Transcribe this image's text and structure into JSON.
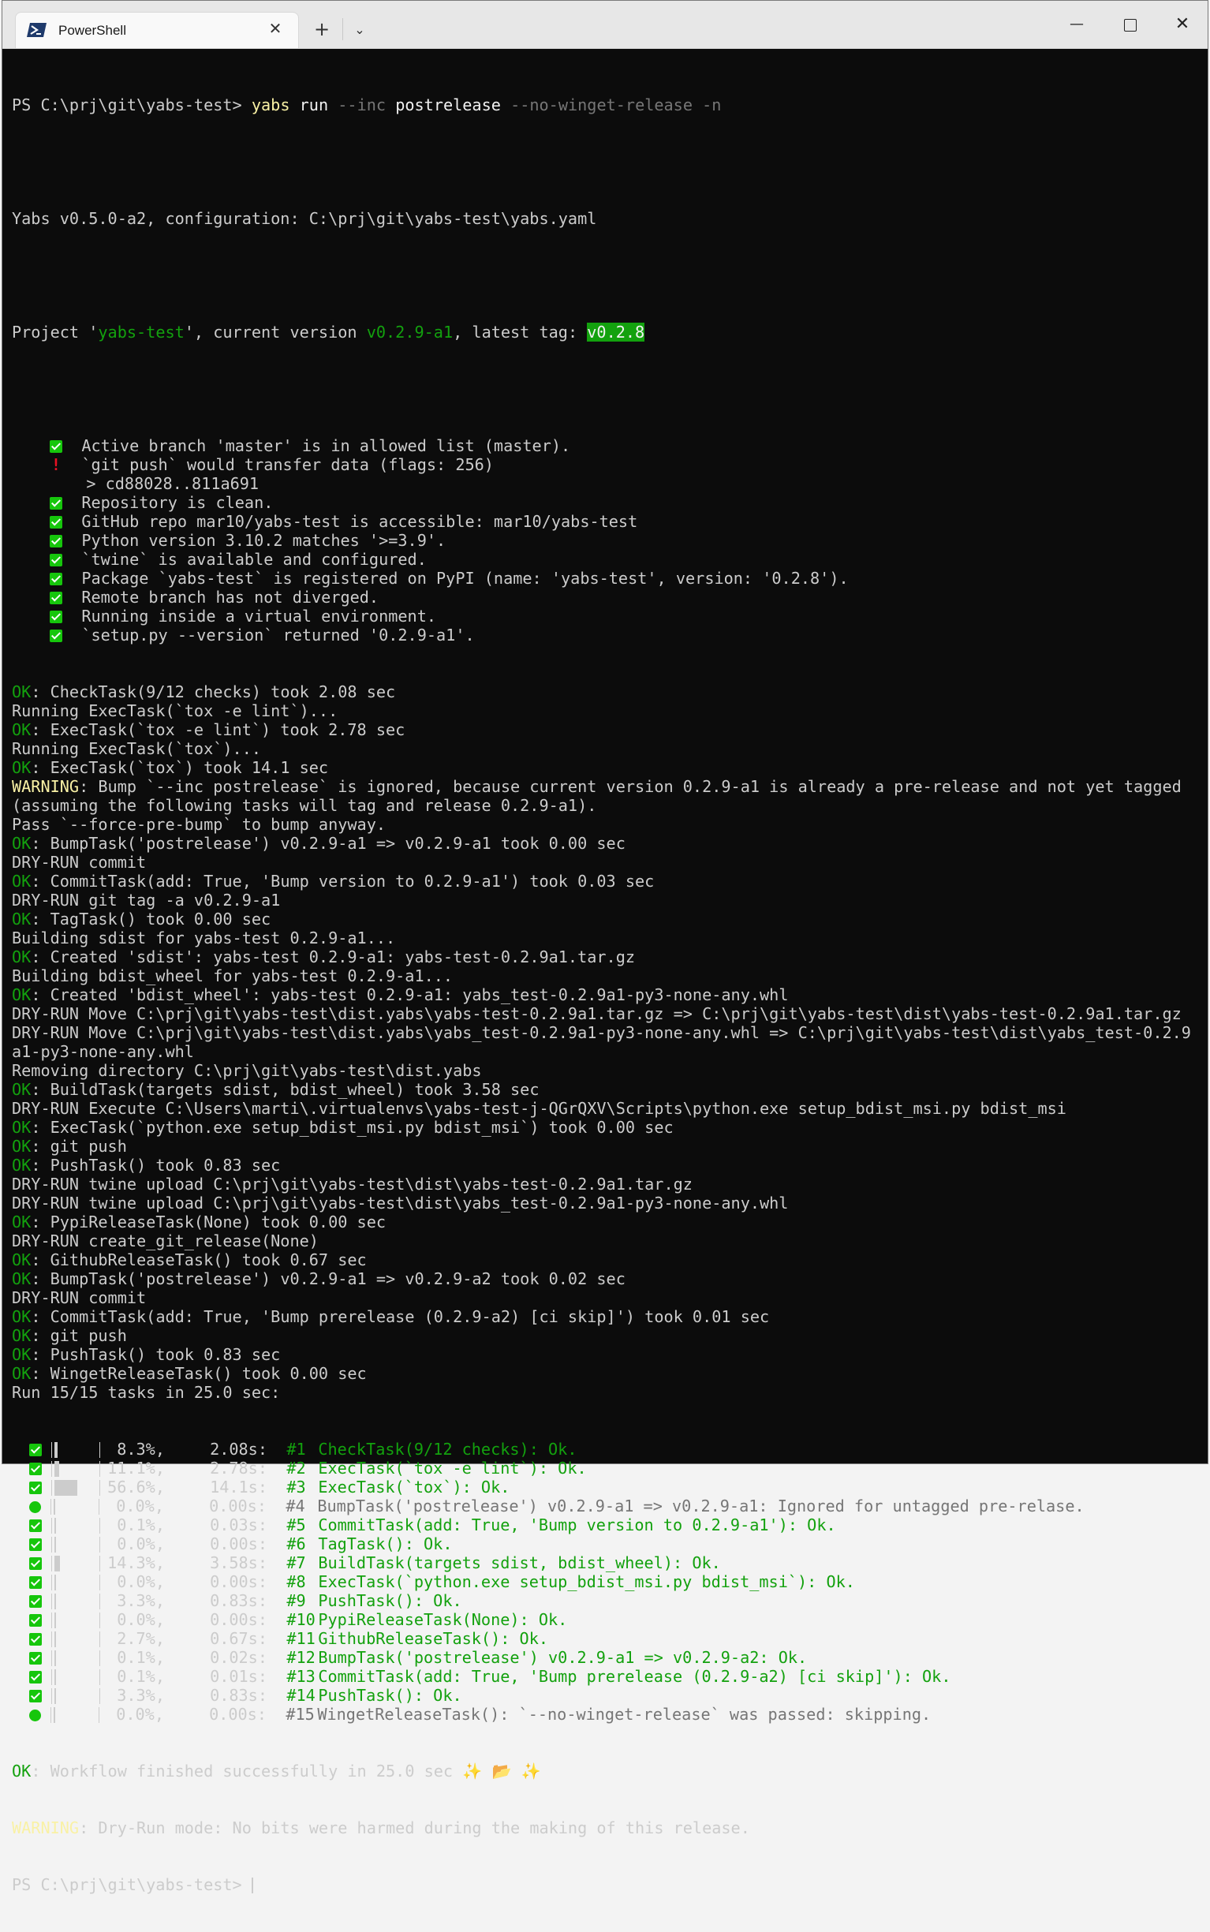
{
  "window": {
    "tab_title": "PowerShell",
    "tab_close": "✕",
    "new_tab": "+",
    "dropdown": "⌄",
    "minimize": "—",
    "close": "✕"
  },
  "terminal": {
    "prompt": "PS C:\\prj\\git\\yabs-test>",
    "cmd_name": "yabs",
    "cmd_run": "run",
    "cmd_opt1": "--inc",
    "cmd_arg1": "postrelease",
    "cmd_opt2": "--no-winget-release -n",
    "config_line": "Yabs v0.5.0-a2, configuration: C:\\prj\\git\\yabs-test\\yabs.yaml",
    "project_prefix": "Project '",
    "project_name": "yabs-test",
    "project_mid": "', current version ",
    "project_version": "v0.2.9-a1",
    "project_tag_label": ", latest tag: ",
    "project_tag": "v0.2.8",
    "checks": [
      {
        "status": "ok",
        "text": "Active branch 'master' is in allowed list (master)."
      },
      {
        "status": "warn",
        "text": "`git push` would transfer data (flags: 256)"
      },
      {
        "status": "none",
        "text": "> cd88028..811a691"
      },
      {
        "status": "ok",
        "text": "Repository is clean."
      },
      {
        "status": "ok",
        "text": "GitHub repo mar10/yabs-test is accessible: mar10/yabs-test"
      },
      {
        "status": "ok",
        "text": "Python version 3.10.2 matches '>=3.9'."
      },
      {
        "status": "ok",
        "text": "`twine` is available and configured."
      },
      {
        "status": "ok",
        "text": "Package `yabs-test` is registered on PyPI (name: 'yabs-test', version: '0.2.8')."
      },
      {
        "status": "ok",
        "text": "Remote branch has not diverged."
      },
      {
        "status": "ok",
        "text": "Running inside a virtual environment."
      },
      {
        "status": "ok",
        "text": "`setup.py --version` returned '0.2.9-a1'."
      }
    ],
    "log": [
      {
        "kind": "ok",
        "text": "CheckTask(9/12 checks) took 2.08 sec"
      },
      {
        "kind": "plain",
        "text": "Running ExecTask(`tox -e lint`)..."
      },
      {
        "kind": "ok",
        "text": "ExecTask(`tox -e lint`) took 2.78 sec"
      },
      {
        "kind": "plain",
        "text": "Running ExecTask(`tox`)..."
      },
      {
        "kind": "ok",
        "text": "ExecTask(`tox`) took 14.1 sec"
      },
      {
        "kind": "warn",
        "text": "Bump `--inc postrelease` is ignored, because current version 0.2.9-a1 is already a pre-release and not yet tagged"
      },
      {
        "kind": "plain",
        "text": "(assuming the following tasks will tag and release 0.2.9-a1)."
      },
      {
        "kind": "plain",
        "text": "Pass `--force-pre-bump` to bump anyway."
      },
      {
        "kind": "ok",
        "text": "BumpTask('postrelease') v0.2.9-a1 => v0.2.9-a1 took 0.00 sec"
      },
      {
        "kind": "plain",
        "text": "DRY-RUN commit"
      },
      {
        "kind": "ok",
        "text": "CommitTask(add: True, 'Bump version to 0.2.9-a1') took 0.03 sec"
      },
      {
        "kind": "plain",
        "text": "DRY-RUN git tag -a v0.2.9-a1"
      },
      {
        "kind": "ok",
        "text": "TagTask() took 0.00 sec"
      },
      {
        "kind": "plain",
        "text": "Building sdist for yabs-test 0.2.9-a1..."
      },
      {
        "kind": "ok",
        "text": "Created 'sdist': yabs-test 0.2.9-a1: yabs-test-0.2.9a1.tar.gz"
      },
      {
        "kind": "plain",
        "text": "Building bdist_wheel for yabs-test 0.2.9-a1..."
      },
      {
        "kind": "ok",
        "text": "Created 'bdist_wheel': yabs-test 0.2.9-a1: yabs_test-0.2.9a1-py3-none-any.whl"
      },
      {
        "kind": "plain",
        "text": "DRY-RUN Move C:\\prj\\git\\yabs-test\\dist.yabs\\yabs-test-0.2.9a1.tar.gz => C:\\prj\\git\\yabs-test\\dist\\yabs-test-0.2.9a1.tar.gz"
      },
      {
        "kind": "plain",
        "text": "DRY-RUN Move C:\\prj\\git\\yabs-test\\dist.yabs\\yabs_test-0.2.9a1-py3-none-any.whl => C:\\prj\\git\\yabs-test\\dist\\yabs_test-0.2.9"
      },
      {
        "kind": "plain",
        "text": "a1-py3-none-any.whl"
      },
      {
        "kind": "plain",
        "text": "Removing directory C:\\prj\\git\\yabs-test\\dist.yabs"
      },
      {
        "kind": "ok",
        "text": "BuildTask(targets sdist, bdist_wheel) took 3.58 sec"
      },
      {
        "kind": "plain",
        "text": "DRY-RUN Execute C:\\Users\\marti\\.virtualenvs\\yabs-test-j-QGrQXV\\Scripts\\python.exe setup_bdist_msi.py bdist_msi"
      },
      {
        "kind": "ok",
        "text": "ExecTask(`python.exe setup_bdist_msi.py bdist_msi`) took 0.00 sec"
      },
      {
        "kind": "ok",
        "text": "git push"
      },
      {
        "kind": "ok",
        "text": "PushTask() took 0.83 sec"
      },
      {
        "kind": "plain",
        "text": "DRY-RUN twine upload C:\\prj\\git\\yabs-test\\dist\\yabs-test-0.2.9a1.tar.gz"
      },
      {
        "kind": "plain",
        "text": "DRY-RUN twine upload C:\\prj\\git\\yabs-test\\dist\\yabs_test-0.2.9a1-py3-none-any.whl"
      },
      {
        "kind": "ok",
        "text": "PypiReleaseTask(None) took 0.00 sec"
      },
      {
        "kind": "plain",
        "text": "DRY-RUN create_git_release(None)"
      },
      {
        "kind": "ok",
        "text": "GithubReleaseTask() took 0.67 sec"
      },
      {
        "kind": "ok",
        "text": "BumpTask('postrelease') v0.2.9-a1 => v0.2.9-a2 took 0.02 sec"
      },
      {
        "kind": "plain",
        "text": "DRY-RUN commit"
      },
      {
        "kind": "ok",
        "text": "CommitTask(add: True, 'Bump prerelease (0.2.9-a2) [ci skip]') took 0.01 sec"
      },
      {
        "kind": "ok",
        "text": "git push"
      },
      {
        "kind": "ok",
        "text": "PushTask() took 0.83 sec"
      },
      {
        "kind": "ok",
        "text": "WingetReleaseTask() took 0.00 sec"
      },
      {
        "kind": "plain",
        "text": "Run 15/15 tasks in 25.0 sec:"
      }
    ],
    "ok_label": "OK",
    "warn_label": "WARNING",
    "summary": [
      {
        "status": "ok",
        "pct": "8.3%,",
        "time": "2.08s:",
        "num": "#1",
        "text": "CheckTask(9/12 checks): Ok.",
        "fill": 0.083,
        "dim": false
      },
      {
        "status": "ok",
        "pct": "11.1%,",
        "time": "2.78s:",
        "num": "#2",
        "text": "ExecTask(`tox -e lint`): Ok.",
        "fill": 0.111,
        "dim": false
      },
      {
        "status": "ok",
        "pct": "56.6%,",
        "time": "14.1s:",
        "num": "#3",
        "text": "ExecTask(`tox`): Ok.",
        "fill": 0.566,
        "dim": false
      },
      {
        "status": "skip",
        "pct": "0.0%,",
        "time": "0.00s:",
        "num": "#4",
        "text": "BumpTask('postrelease') v0.2.9-a1 => v0.2.9-a1: Ignored for untagged pre-relase.",
        "fill": 0.0,
        "dim": true
      },
      {
        "status": "ok",
        "pct": "0.1%,",
        "time": "0.03s:",
        "num": "#5",
        "text": "CommitTask(add: True, 'Bump version to 0.2.9-a1'): Ok.",
        "fill": 0.001,
        "dim": false
      },
      {
        "status": "ok",
        "pct": "0.0%,",
        "time": "0.00s:",
        "num": "#6",
        "text": "TagTask(): Ok.",
        "fill": 0.0,
        "dim": false
      },
      {
        "status": "ok",
        "pct": "14.3%,",
        "time": "3.58s:",
        "num": "#7",
        "text": "BuildTask(targets sdist, bdist_wheel): Ok.",
        "fill": 0.143,
        "dim": false
      },
      {
        "status": "ok",
        "pct": "0.0%,",
        "time": "0.00s:",
        "num": "#8",
        "text": "ExecTask(`python.exe setup_bdist_msi.py bdist_msi`): Ok.",
        "fill": 0.0,
        "dim": false
      },
      {
        "status": "ok",
        "pct": "3.3%,",
        "time": "0.83s:",
        "num": "#9",
        "text": "PushTask(): Ok.",
        "fill": 0.033,
        "dim": false
      },
      {
        "status": "ok",
        "pct": "0.0%,",
        "time": "0.00s:",
        "num": "#10",
        "text": "PypiReleaseTask(None): Ok.",
        "fill": 0.0,
        "dim": false
      },
      {
        "status": "ok",
        "pct": "2.7%,",
        "time": "0.67s:",
        "num": "#11",
        "text": "GithubReleaseTask(): Ok.",
        "fill": 0.027,
        "dim": false
      },
      {
        "status": "ok",
        "pct": "0.1%,",
        "time": "0.02s:",
        "num": "#12",
        "text": "BumpTask('postrelease') v0.2.9-a1 => v0.2.9-a2: Ok.",
        "fill": 0.001,
        "dim": false
      },
      {
        "status": "ok",
        "pct": "0.1%,",
        "time": "0.01s:",
        "num": "#13",
        "text": "CommitTask(add: True, 'Bump prerelease (0.2.9-a2) [ci skip]'): Ok.",
        "fill": 0.001,
        "dim": false
      },
      {
        "status": "ok",
        "pct": "3.3%,",
        "time": "0.83s:",
        "num": "#14",
        "text": "PushTask(): Ok.",
        "fill": 0.033,
        "dim": false
      },
      {
        "status": "skip",
        "pct": "0.0%,",
        "time": "0.00s:",
        "num": "#15",
        "text": "WingetReleaseTask(): `--no-winget-release` was passed: skipping.",
        "fill": 0.0,
        "dim": true
      }
    ],
    "final_ok": "Workflow finished successfully in 25.0 sec",
    "final_ok_emoji": [
      "✨",
      "📂",
      "✨"
    ],
    "final_warn": "Dry-Run mode: No bits were harmed during the making of this release.",
    "final_prompt": "PS C:\\prj\\git\\yabs-test>"
  }
}
